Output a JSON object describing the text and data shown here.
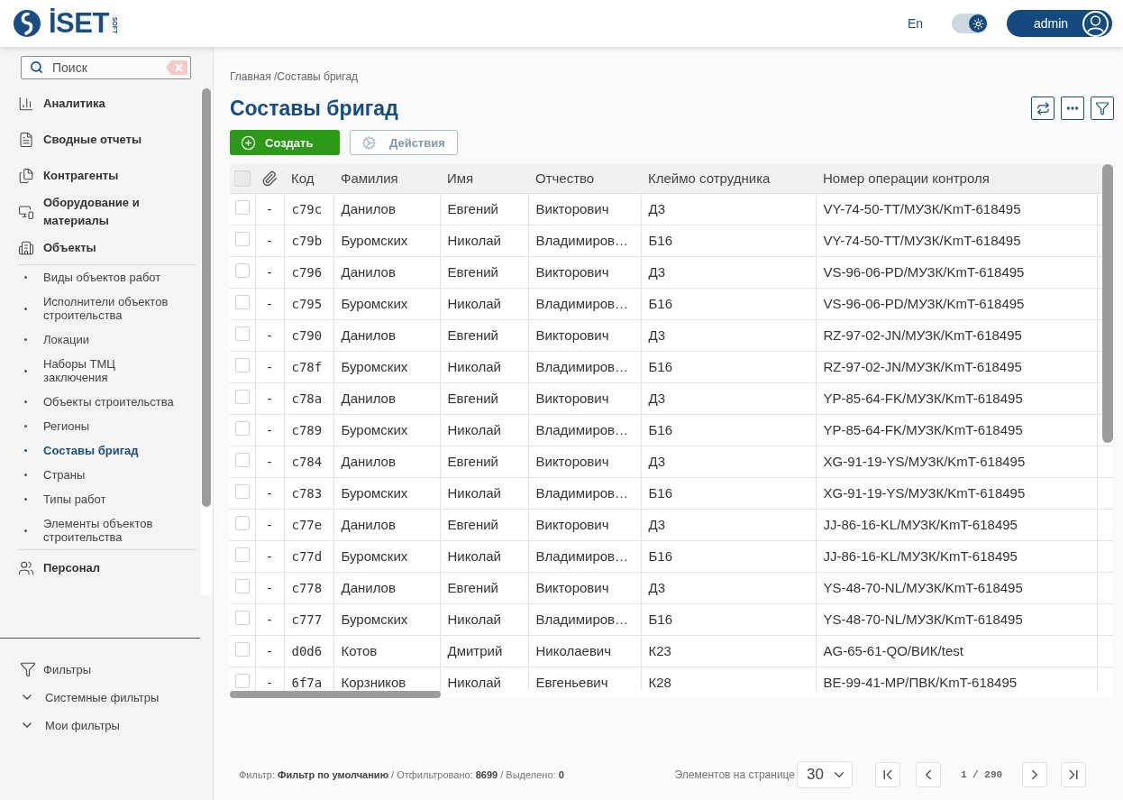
{
  "header": {
    "logo": {
      "text": "İSET",
      "subtext": "SOFT"
    },
    "language": {
      "label": "En",
      "selected": true
    },
    "theme_toggle": {
      "on": true
    },
    "user": {
      "name": "admin"
    }
  },
  "sidebar": {
    "search": {
      "placeholder": "Поиск"
    },
    "items": [
      {
        "label": "Аналитика",
        "selected": false
      },
      {
        "label": "Сводные отчеты",
        "selected": false
      },
      {
        "label": "Контрагенты",
        "selected": false
      },
      {
        "label": "Оборудование и материалы",
        "selected": false
      },
      {
        "label": "Объекты",
        "selected": false,
        "expanded": true,
        "children": [
          {
            "label": "Виды объектов работ",
            "selected": false
          },
          {
            "label": "Исполнители объектов строительства",
            "selected": false
          },
          {
            "label": "Локации",
            "selected": false
          },
          {
            "label": "Наборы ТМЦ\nзаключения",
            "selected": false
          },
          {
            "label": "Объекты строительства",
            "selected": false
          },
          {
            "label": "Регионы",
            "selected": false
          },
          {
            "label": "Составы бригад",
            "selected": true
          },
          {
            "label": "Страны",
            "selected": false
          },
          {
            "label": "Типы работ",
            "selected": false
          },
          {
            "label": "Элементы объектов строительства",
            "selected": false
          }
        ]
      },
      {
        "label": "Персонал",
        "selected": false
      }
    ],
    "filters": {
      "title": "Фильтры",
      "groups": [
        {
          "label": "Системные фильтры",
          "expanded": false
        },
        {
          "label": "Мои фильтры",
          "expanded": false
        }
      ]
    }
  },
  "main": {
    "breadcrumb": "Главная /Составы бригад",
    "title": "Составы бригад",
    "toolbar": [
      {
        "kind": "create",
        "label": "Создать",
        "disabled": false
      },
      {
        "kind": "actions",
        "label": "Действия",
        "disabled": true
      }
    ],
    "table": {
      "select_all": {
        "checked": false
      },
      "columns": [
        {
          "label": "Код",
          "kind": "code"
        },
        {
          "label": "Фамилия",
          "kind": "text"
        },
        {
          "label": "Имя",
          "kind": "text"
        },
        {
          "label": "Отчество",
          "kind": "text"
        },
        {
          "label": "Клеймо сотрудника",
          "kind": "text"
        },
        {
          "label": "Номер операции контроля",
          "kind": "text"
        }
      ],
      "rows": [
        {
          "selected": false,
          "attachment": "-",
          "cells": [
            "c79c",
            "Данилов",
            "Евгений",
            "Викторович",
            "Д3",
            "VY-74-50-TT/МУЗК/KmT-618495"
          ]
        },
        {
          "selected": false,
          "attachment": "-",
          "cells": [
            "c79b",
            "Буромских",
            "Николай",
            "Владимиров…",
            "Б16",
            "VY-74-50-TT/МУЗК/KmT-618495"
          ]
        },
        {
          "selected": false,
          "attachment": "-",
          "cells": [
            "c796",
            "Данилов",
            "Евгений",
            "Викторович",
            "Д3",
            "VS-96-06-PD/МУЗК/KmT-618495"
          ]
        },
        {
          "selected": false,
          "attachment": "-",
          "cells": [
            "c795",
            "Буромских",
            "Николай",
            "Владимиров…",
            "Б16",
            "VS-96-06-PD/МУЗК/KmT-618495"
          ]
        },
        {
          "selected": false,
          "attachment": "-",
          "cells": [
            "c790",
            "Данилов",
            "Евгений",
            "Викторович",
            "Д3",
            "RZ-97-02-JN/МУЗК/KmT-618495"
          ]
        },
        {
          "selected": false,
          "attachment": "-",
          "cells": [
            "c78f",
            "Буромских",
            "Николай",
            "Владимиров…",
            "Б16",
            "RZ-97-02-JN/МУЗК/KmT-618495"
          ]
        },
        {
          "selected": false,
          "attachment": "-",
          "cells": [
            "c78a",
            "Данилов",
            "Евгений",
            "Викторович",
            "Д3",
            "YP-85-64-FK/МУЗК/KmT-618495"
          ]
        },
        {
          "selected": false,
          "attachment": "-",
          "cells": [
            "c789",
            "Буромских",
            "Николай",
            "Владимиров…",
            "Б16",
            "YP-85-64-FK/МУЗК/KmT-618495"
          ]
        },
        {
          "selected": false,
          "attachment": "-",
          "cells": [
            "c784",
            "Данилов",
            "Евгений",
            "Викторович",
            "Д3",
            "XG-91-19-YS/МУЗК/KmT-618495"
          ]
        },
        {
          "selected": false,
          "attachment": "-",
          "cells": [
            "c783",
            "Буромских",
            "Николай",
            "Владимиров…",
            "Б16",
            "XG-91-19-YS/МУЗК/KmT-618495"
          ]
        },
        {
          "selected": false,
          "attachment": "-",
          "cells": [
            "c77e",
            "Данилов",
            "Евгений",
            "Викторович",
            "Д3",
            "JJ-86-16-KL/МУЗК/KmT-618495"
          ]
        },
        {
          "selected": false,
          "attachment": "-",
          "cells": [
            "c77d",
            "Буромских",
            "Николай",
            "Владимиров…",
            "Б16",
            "JJ-86-16-KL/МУЗК/KmT-618495"
          ]
        },
        {
          "selected": false,
          "attachment": "-",
          "cells": [
            "c778",
            "Данилов",
            "Евгений",
            "Викторович",
            "Д3",
            "YS-48-70-NL/МУЗК/KmT-618495"
          ]
        },
        {
          "selected": false,
          "attachment": "-",
          "cells": [
            "c777",
            "Буромских",
            "Николай",
            "Владимиров…",
            "Б16",
            "YS-48-70-NL/МУЗК/KmT-618495"
          ]
        },
        {
          "selected": false,
          "attachment": "-",
          "cells": [
            "d0d6",
            "Котов",
            "Дмитрий",
            "Николаевич",
            "К23",
            "AG-65-61-QO/ВИК/test"
          ]
        },
        {
          "selected": false,
          "attachment": "-",
          "cells": [
            "6f7a",
            "Корзников",
            "Николай",
            "Евгеньевич",
            "К28",
            "BE-99-41-MP/ПВК/KmT-618495"
          ]
        }
      ]
    },
    "status": "Фильтр: **Фильтр по умолчанию** / Отфильтровано: **8699** / Выделено: **0**",
    "pagination": {
      "page_size_label": "Элементов на странице",
      "page_size": "30",
      "page": "1 / 290"
    }
  }
}
